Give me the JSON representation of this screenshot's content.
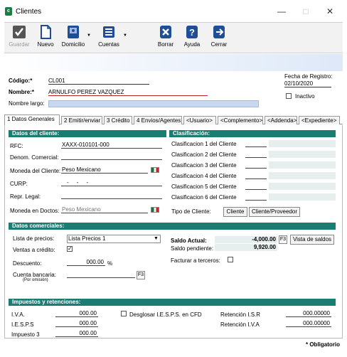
{
  "window": {
    "title": "Clientes",
    "icon": "clientes-app-icon",
    "controls": {
      "minimize": "—",
      "maximize": "□",
      "close": "✕"
    }
  },
  "toolbar": {
    "guardar": "Guardar",
    "nuevo": "Nuevo",
    "domicilio": "Domicilio",
    "cuentas": "Cuentas",
    "borrar": "Borrar",
    "ayuda": "Ayuda",
    "cerrar": "Cerrar"
  },
  "header": {
    "codigo_label": "Código:*",
    "codigo_value": "CL001",
    "nombre_label": "Nombre:*",
    "nombre_value": "ARNULFO PEREZ VAZQUEZ",
    "nombre_largo_label": "Nombre largo:",
    "nombre_largo_value": "",
    "fecha_label": "Fecha de Registro:",
    "fecha_value": "02/10/2020",
    "inactivo_label": "Inactivo"
  },
  "tabs": [
    {
      "label": "1 Datos Generales"
    },
    {
      "label": "2 Emitir/enviar"
    },
    {
      "label": "3 Crédito"
    },
    {
      "label": "4 Envios/Agentes"
    },
    {
      "label": "<Usuario>"
    },
    {
      "label": "<Complemento>"
    },
    {
      "label": "<Addenda>"
    },
    {
      "label": "<Expediente>"
    }
  ],
  "datos_cliente": {
    "title": "Datos del cliente:",
    "rfc_label": "RFC:",
    "rfc_value": "XAXX-010101-000",
    "denom_label": "Denom. Comercial:",
    "denom_value": "",
    "moneda_label": "Moneda del Cliente:",
    "moneda_value": "Peso Mexicano",
    "curp_label": "CURP:",
    "curp_value": "-     -     -",
    "repr_label": "Repr. Legal:",
    "repr_value": "",
    "moneda_doctos_label": "Moneda en Doctos:",
    "moneda_doctos_value": "Peso Mexicano"
  },
  "clasificacion": {
    "title": "Clasificación:",
    "items": [
      {
        "label": "Clasificacion 1 del Cliente"
      },
      {
        "label": "Clasificacion 2 del Cliente"
      },
      {
        "label": "Clasificacion 3 del Cliente"
      },
      {
        "label": "Clasificacion 4 del Cliente"
      },
      {
        "label": "Clasificacion 5 del Cliente"
      },
      {
        "label": "Clasificacion 6 del Cliente"
      }
    ],
    "tipo_label": "Tipo de Cliente:",
    "tipo_cliente": "Cliente",
    "tipo_proveedor": "Cliente/Proveedor"
  },
  "comerciales": {
    "title": "Datos comerciales:",
    "lista_label": "Lista de precios:",
    "lista_value": "Lista Precios 1",
    "ventas_label": "Ventas a crédito:",
    "ventas_checked": "✓",
    "descuento_label": "Descuento:",
    "descuento_value": "000.00",
    "descuento_unit": "%",
    "cuenta_label": "Cuenta bancaria:",
    "cuenta_sub": "(Por omisión)",
    "saldo_actual_label": "Saldo Actual:",
    "saldo_actual_value": "-4,000.00",
    "saldo_pend_label": "Saldo pendiente:",
    "saldo_pend_value": "9,920.00",
    "f3": "F3",
    "vista_saldos": "Vista de saldos",
    "facturar_label": "Facturar a terceros:"
  },
  "impuestos": {
    "title": "Impuestos y retenciones:",
    "iva_label": "I.V.A.",
    "iva_value": "000.00",
    "iesps_label": "I.E.S.P.S",
    "iesps_value": "000.00",
    "imp3_label": "Impuesto 3",
    "imp3_value": "000.00",
    "desglosar_label": "Desglosar I.E.S.P.S. en CFD",
    "ret_isr_label": "Retención I.S.R",
    "ret_isr_value": "000.00000",
    "ret_iva_label": "Retención I.V.A",
    "ret_iva_value": "000.00000"
  },
  "footer": {
    "obligatorio": "* Obligatorio"
  },
  "colors": {
    "section_header": "#1b7c72",
    "accent_blue": "#2a5caa"
  }
}
